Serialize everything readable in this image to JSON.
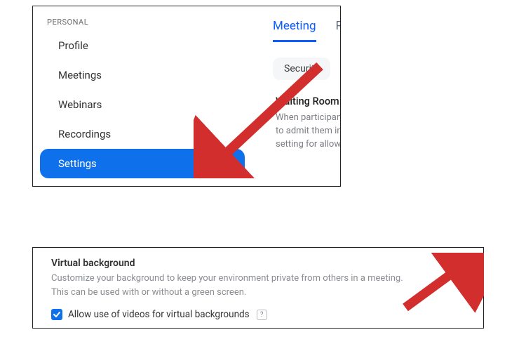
{
  "sidebar": {
    "section_label": "PERSONAL",
    "items": [
      {
        "label": "Profile"
      },
      {
        "label": "Meetings"
      },
      {
        "label": "Webinars"
      },
      {
        "label": "Recordings"
      },
      {
        "label": "Settings"
      }
    ],
    "active_index": 4
  },
  "tabs": {
    "items": [
      {
        "label": "Meeting"
      },
      {
        "label": "Re"
      }
    ],
    "active_index": 0
  },
  "subtab": {
    "label": "Security"
  },
  "waiting_room": {
    "title": "Waiting Room",
    "desc_line1": "When participants",
    "desc_line2": "to admit them ind",
    "desc_line3": "setting for allowin"
  },
  "virtual_background": {
    "title": "Virtual background",
    "desc": "Customize your background to keep your environment private from others in a meeting. This can be used with or without a green screen.",
    "toggle_on": true,
    "allow_videos_label": "Allow use of videos for virtual backgrounds",
    "allow_videos_checked": true,
    "help_icon": "?"
  },
  "colors": {
    "accent": "#0e71eb",
    "tab_active": "#0e5cff",
    "arrow": "#d32e2e"
  }
}
